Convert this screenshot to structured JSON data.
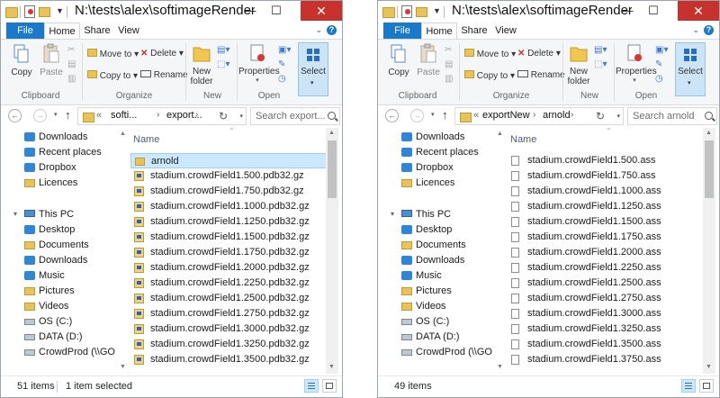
{
  "windows": [
    {
      "title": "N:\\tests\\alex\\softimageRender\\export",
      "tabs": {
        "file": "File",
        "home": "Home",
        "share": "Share",
        "view": "View"
      },
      "ribbon": {
        "copy": "Copy",
        "paste": "Paste",
        "move_to": "Move to",
        "copy_to": "Copy to",
        "delete": "Delete",
        "rename": "Rename",
        "new_folder_line1": "New",
        "new_folder_line2": "folder",
        "properties": "Properties",
        "select": "Select",
        "groups": {
          "clipboard": "Clipboard",
          "organize": "Organize",
          "new": "New",
          "open": "Open"
        }
      },
      "address": {
        "overflow": "«",
        "crumbs": [
          "softi...",
          "export..."
        ]
      },
      "search_placeholder": "Search export...",
      "nav_items": [
        {
          "label": "Downloads",
          "icon": "downloads-icon"
        },
        {
          "label": "Recent places",
          "icon": "recent-places-icon"
        },
        {
          "label": "Dropbox",
          "icon": "dropbox-icon"
        },
        {
          "label": "Licences",
          "icon": "folder-icon"
        },
        {
          "label": "This PC",
          "icon": "computer-icon"
        },
        {
          "label": "Desktop",
          "icon": "desktop-icon"
        },
        {
          "label": "Documents",
          "icon": "documents-icon"
        },
        {
          "label": "Downloads",
          "icon": "downloads-icon"
        },
        {
          "label": "Music",
          "icon": "music-icon"
        },
        {
          "label": "Pictures",
          "icon": "pictures-icon"
        },
        {
          "label": "Videos",
          "icon": "videos-icon"
        },
        {
          "label": "OS (C:)",
          "icon": "drive-icon"
        },
        {
          "label": "DATA (D:)",
          "icon": "drive-icon"
        },
        {
          "label": "CrowdProd (\\\\GO",
          "icon": "network-drive-icon"
        }
      ],
      "column_name": "Name",
      "files": [
        {
          "name": "arnold",
          "type": "folder",
          "selected": true
        },
        {
          "name": "stadium.crowdField1.500.pdb32.gz",
          "type": "gz"
        },
        {
          "name": "stadium.crowdField1.750.pdb32.gz",
          "type": "gz"
        },
        {
          "name": "stadium.crowdField1.1000.pdb32.gz",
          "type": "gz"
        },
        {
          "name": "stadium.crowdField1.1250.pdb32.gz",
          "type": "gz"
        },
        {
          "name": "stadium.crowdField1.1500.pdb32.gz",
          "type": "gz"
        },
        {
          "name": "stadium.crowdField1.1750.pdb32.gz",
          "type": "gz"
        },
        {
          "name": "stadium.crowdField1.2000.pdb32.gz",
          "type": "gz"
        },
        {
          "name": "stadium.crowdField1.2250.pdb32.gz",
          "type": "gz"
        },
        {
          "name": "stadium.crowdField1.2500.pdb32.gz",
          "type": "gz"
        },
        {
          "name": "stadium.crowdField1.2750.pdb32.gz",
          "type": "gz"
        },
        {
          "name": "stadium.crowdField1.3000.pdb32.gz",
          "type": "gz"
        },
        {
          "name": "stadium.crowdField1.3250.pdb32.gz",
          "type": "gz"
        },
        {
          "name": "stadium.crowdField1.3500.pdb32.gz",
          "type": "gz"
        }
      ],
      "status": {
        "items": "51 items",
        "selected": "1 item selected"
      }
    },
    {
      "title": "N:\\tests\\alex\\softimageRender\\expo",
      "tabs": {
        "file": "File",
        "home": "Home",
        "share": "Share",
        "view": "View"
      },
      "ribbon": {
        "copy": "Copy",
        "paste": "Paste",
        "move_to": "Move to",
        "copy_to": "Copy to",
        "delete": "Delete",
        "rename": "Rename",
        "new_folder_line1": "New",
        "new_folder_line2": "folder",
        "properties": "Properties",
        "select": "Select",
        "groups": {
          "clipboard": "Clipboard",
          "organize": "Organize",
          "new": "New",
          "open": "Open"
        }
      },
      "address": {
        "overflow": "«",
        "crumbs": [
          "exportNew",
          "arnold"
        ]
      },
      "search_placeholder": "Search arnold",
      "nav_items": [
        {
          "label": "Downloads",
          "icon": "downloads-icon"
        },
        {
          "label": "Recent places",
          "icon": "recent-places-icon"
        },
        {
          "label": "Dropbox",
          "icon": "dropbox-icon"
        },
        {
          "label": "Licences",
          "icon": "folder-icon"
        },
        {
          "label": "This PC",
          "icon": "computer-icon"
        },
        {
          "label": "Desktop",
          "icon": "desktop-icon"
        },
        {
          "label": "Documents",
          "icon": "documents-icon"
        },
        {
          "label": "Downloads",
          "icon": "downloads-icon"
        },
        {
          "label": "Music",
          "icon": "music-icon"
        },
        {
          "label": "Pictures",
          "icon": "pictures-icon"
        },
        {
          "label": "Videos",
          "icon": "videos-icon"
        },
        {
          "label": "OS (C:)",
          "icon": "drive-icon"
        },
        {
          "label": "DATA (D:)",
          "icon": "drive-icon"
        },
        {
          "label": "CrowdProd (\\\\GO",
          "icon": "network-drive-icon"
        }
      ],
      "column_name": "Name",
      "files": [
        {
          "name": "stadium.crowdField1.500.ass",
          "type": "doc"
        },
        {
          "name": "stadium.crowdField1.750.ass",
          "type": "doc"
        },
        {
          "name": "stadium.crowdField1.1000.ass",
          "type": "doc"
        },
        {
          "name": "stadium.crowdField1.1250.ass",
          "type": "doc"
        },
        {
          "name": "stadium.crowdField1.1500.ass",
          "type": "doc"
        },
        {
          "name": "stadium.crowdField1.1750.ass",
          "type": "doc"
        },
        {
          "name": "stadium.crowdField1.2000.ass",
          "type": "doc"
        },
        {
          "name": "stadium.crowdField1.2250.ass",
          "type": "doc"
        },
        {
          "name": "stadium.crowdField1.2500.ass",
          "type": "doc"
        },
        {
          "name": "stadium.crowdField1.2750.ass",
          "type": "doc"
        },
        {
          "name": "stadium.crowdField1.3000.ass",
          "type": "doc"
        },
        {
          "name": "stadium.crowdField1.3250.ass",
          "type": "doc"
        },
        {
          "name": "stadium.crowdField1.3500.ass",
          "type": "doc"
        },
        {
          "name": "stadium.crowdField1.3750.ass",
          "type": "doc"
        }
      ],
      "status": {
        "items": "49 items",
        "selected": ""
      }
    }
  ],
  "colors": {
    "accent": "#1979ca",
    "close": "#c7332c",
    "selection": "#cce8ff"
  }
}
